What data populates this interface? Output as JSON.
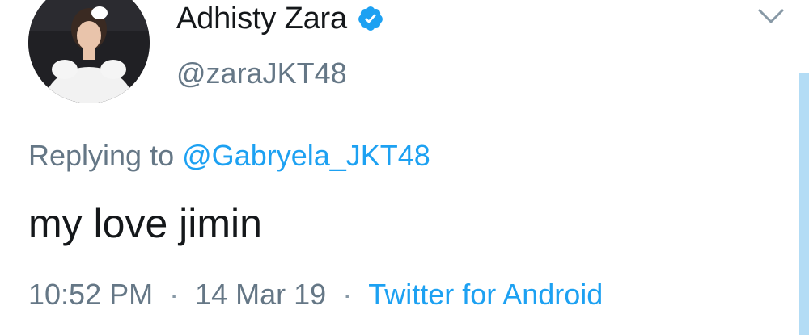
{
  "author": {
    "display_name": "Adhisty Zara",
    "handle": "@zaraJKT48",
    "verified": true,
    "icons": [
      "verified-badge-icon",
      "chevron-down-icon"
    ]
  },
  "reply": {
    "prefix": "Replying to",
    "mention": "@Gabryela_JKT48"
  },
  "tweet": {
    "text": "my love jimin"
  },
  "meta": {
    "time": "10:52 PM",
    "separator": "·",
    "date": "14 Mar 19",
    "source": "Twitter for Android"
  },
  "colors": {
    "primary_text": "#14171a",
    "secondary_text": "#657786",
    "accent_blue": "#1da1f2",
    "background": "#ffffff"
  }
}
